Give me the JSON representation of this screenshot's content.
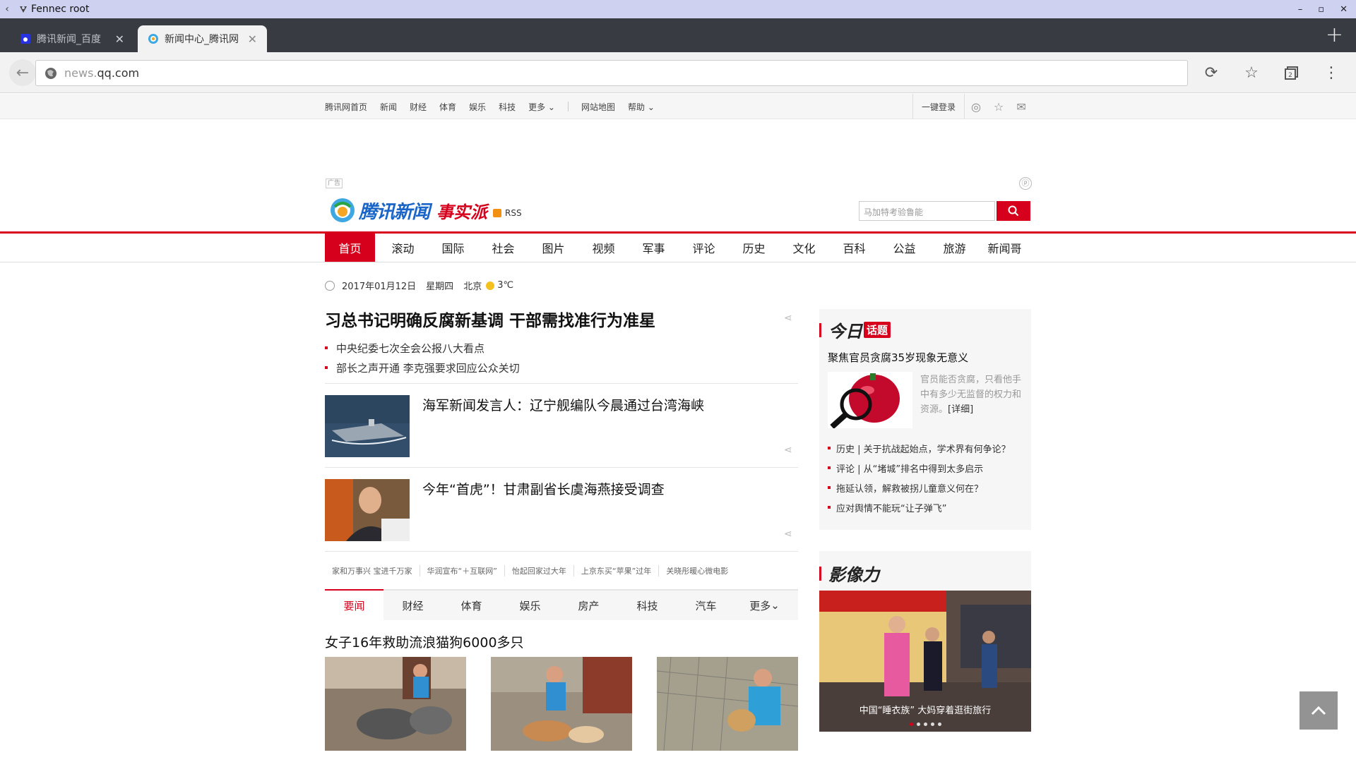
{
  "window": {
    "title": "Fennec root"
  },
  "tabs": [
    {
      "label": "腾讯新闻_百度",
      "active": false
    },
    {
      "label": "新闻中心_腾讯网",
      "active": true
    }
  ],
  "toolbar": {
    "url_dim": "news.",
    "url_host": "qq.com",
    "tab_count": "2"
  },
  "topnav": {
    "links": [
      "腾讯网首页",
      "新闻",
      "财经",
      "体育",
      "娱乐",
      "科技",
      "更多"
    ],
    "links2": [
      "网站地图",
      "帮助"
    ],
    "login": "一键登录"
  },
  "header": {
    "brand": "腾讯新闻",
    "slogan": "事实派",
    "rss": "RSS",
    "search_placeholder": "马加特考验鲁能",
    "ad_tag": "广告"
  },
  "channels": [
    "首页",
    "滚动",
    "国际",
    "社会",
    "图片",
    "视频",
    "军事",
    "评论",
    "历史",
    "文化",
    "百科",
    "公益",
    "旅游",
    "新闻哥"
  ],
  "datebar": {
    "date": "2017年01月12日",
    "weekday": "星期四",
    "city": "北京",
    "temp": "3℃"
  },
  "main": {
    "headline": "习总书记明确反腐新基调 干部需找准行为准星",
    "sub_items": [
      "中央纪委七次全会公报八大看点",
      "部长之声开通 李克强要求回应公众关切"
    ],
    "stories": [
      {
        "title": "海军新闻发言人：辽宁舰编队今晨通过台湾海峡"
      },
      {
        "title": "今年“首虎”！甘肃副省长虞海燕接受调查"
      }
    ],
    "hot_links": [
      "家和万事兴 宝进千万家",
      "华润宣布“＋互联网”",
      "怡起回家过大年",
      "上京东买“苹果”过年",
      "关晓彤暖心微电影"
    ],
    "sub_tabs": [
      "要闻",
      "财经",
      "体育",
      "娱乐",
      "房产",
      "科技",
      "汽车",
      "更多"
    ],
    "featured": "女子16年救助流浪猫狗6000多只"
  },
  "sidebar": {
    "today_head": "今日",
    "today_badge": "话题",
    "topic_title": "聚焦官员贪腐35岁现象无意义",
    "topic_desc": "官员能否贪腐，只看他手中有多少无监督的权力和资源。",
    "topic_more": "[详细]",
    "topic_list": [
      "历史 | 关于抗战起始点，学术界有何争论？",
      "评论 | 从“堵城”排名中得到太多启示",
      "拖延认领，解救被拐儿童意义何在？",
      "应对舆情不能玩“让子弹飞”"
    ],
    "image_head": "影像力",
    "gallery_caption": "中国“睡衣族” 大妈穿着逛街旅行",
    "gallery_active_dot": 0
  },
  "colors": {
    "accent": "#d6001c",
    "brand_blue": "#1a65c8"
  }
}
